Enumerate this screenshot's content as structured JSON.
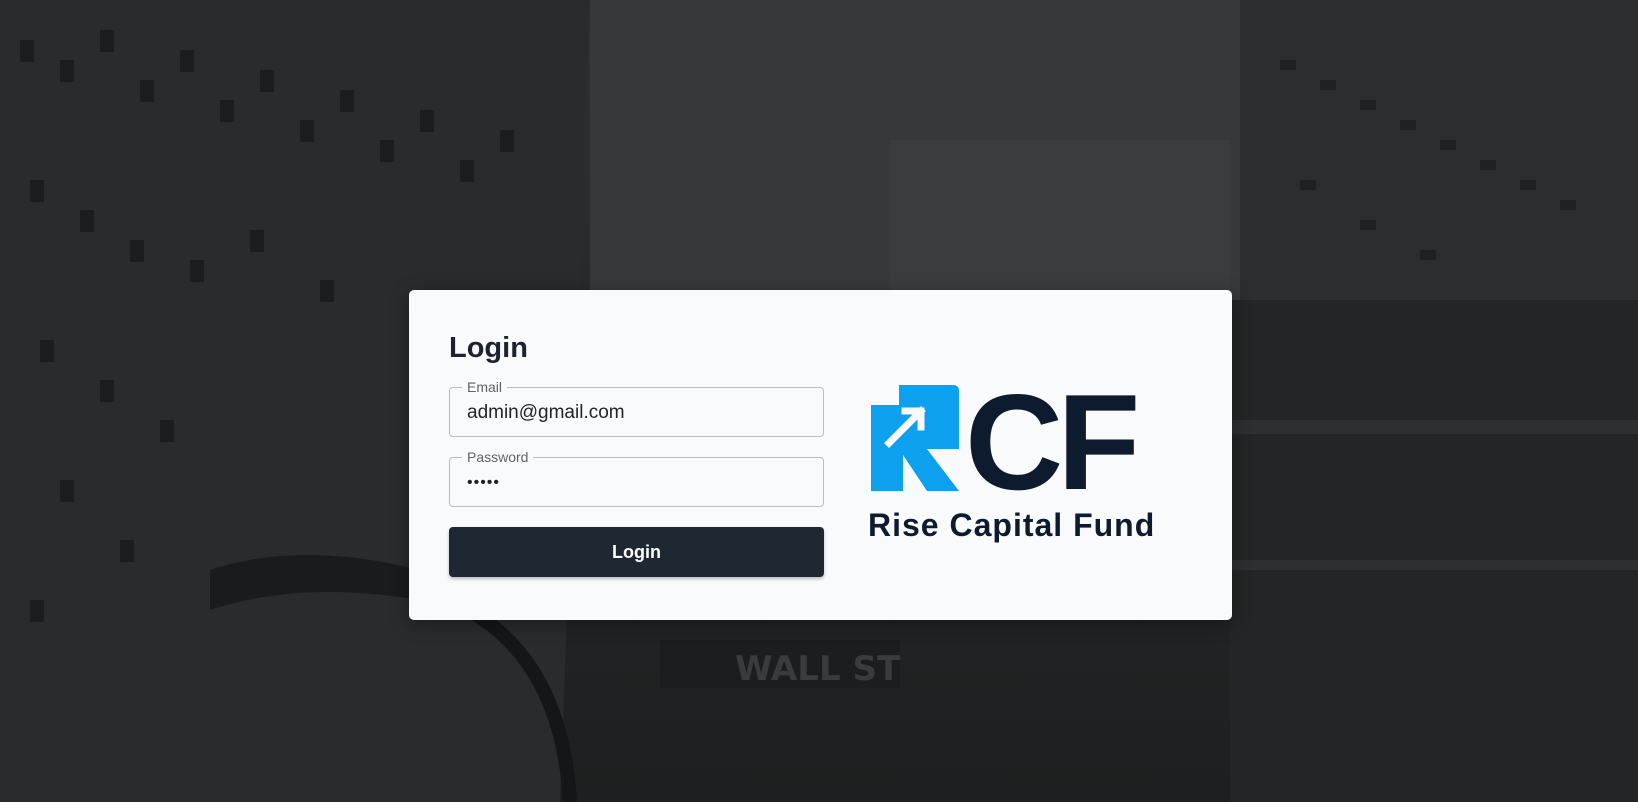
{
  "login": {
    "title": "Login",
    "email": {
      "label": "Email",
      "value": "admin@gmail.com"
    },
    "password": {
      "label": "Password",
      "value": "•••••"
    },
    "button_label": "Login"
  },
  "brand": {
    "logo_letters": "CF",
    "name": "Rise Capital Fund",
    "colors": {
      "accent": "#0da0ef",
      "dark": "#0e1a2e"
    }
  },
  "background": {
    "sign_text": "WALL ST"
  }
}
